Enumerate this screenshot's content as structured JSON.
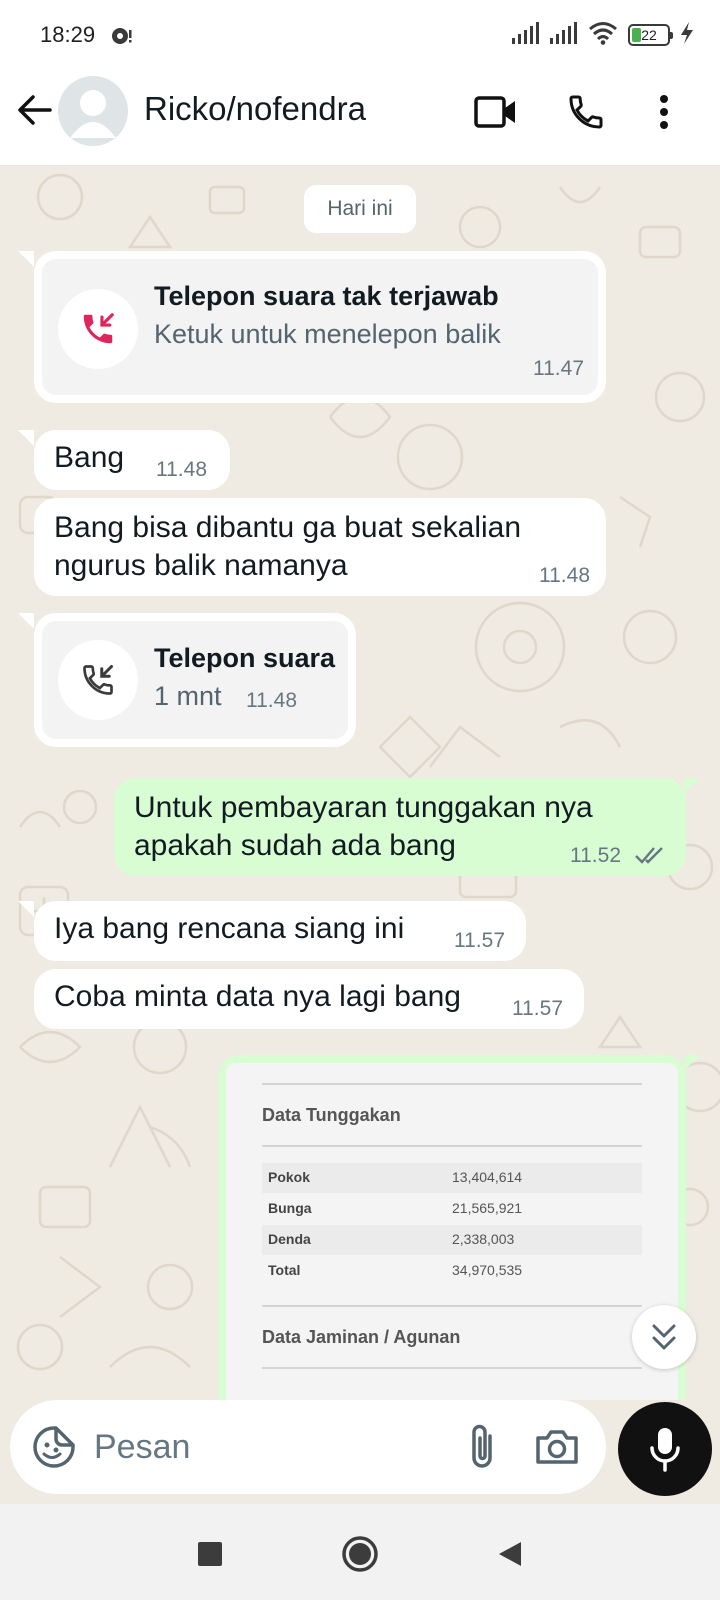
{
  "status_bar": {
    "time": "18:29",
    "battery": "22"
  },
  "header": {
    "contact_name": "Ricko/nofendra"
  },
  "chat": {
    "date_chip": "Hari ini",
    "missed_call": {
      "title": "Telepon suara tak terjawab",
      "subtitle": "Ketuk untuk menelepon balik",
      "time": "11.47"
    },
    "msg1": {
      "text": "Bang",
      "time": "11.48"
    },
    "msg2": {
      "line1": "Bang bisa dibantu ga buat sekalian",
      "line2": "ngurus balik namanya",
      "time": "11.48"
    },
    "voice_call": {
      "title": "Telepon suara",
      "subtitle": "1 mnt",
      "time": "11.48"
    },
    "msg3": {
      "line1": "Untuk pembayaran tunggakan nya",
      "line2": "apakah sudah ada bang",
      "time": "11.52"
    },
    "msg4": {
      "text": "Iya bang rencana siang ini",
      "time": "11.57"
    },
    "msg5": {
      "text": "Coba minta data nya lagi bang",
      "time": "11.57"
    },
    "document": {
      "heading1": "Data Tunggakan",
      "rows": [
        {
          "label": "Pokok",
          "value": "13,404,614"
        },
        {
          "label": "Bunga",
          "value": "21,565,921"
        },
        {
          "label": "Denda",
          "value": "2,338,003"
        },
        {
          "label": "Total",
          "value": "34,970,535"
        }
      ],
      "heading2": "Data Jaminan / Agunan"
    }
  },
  "composer": {
    "placeholder": "Pesan"
  },
  "colors": {
    "incoming": "#ffffff",
    "outgoing": "#d9fdd3",
    "missed_red": "#e0245e",
    "read_tick": "#667781"
  }
}
